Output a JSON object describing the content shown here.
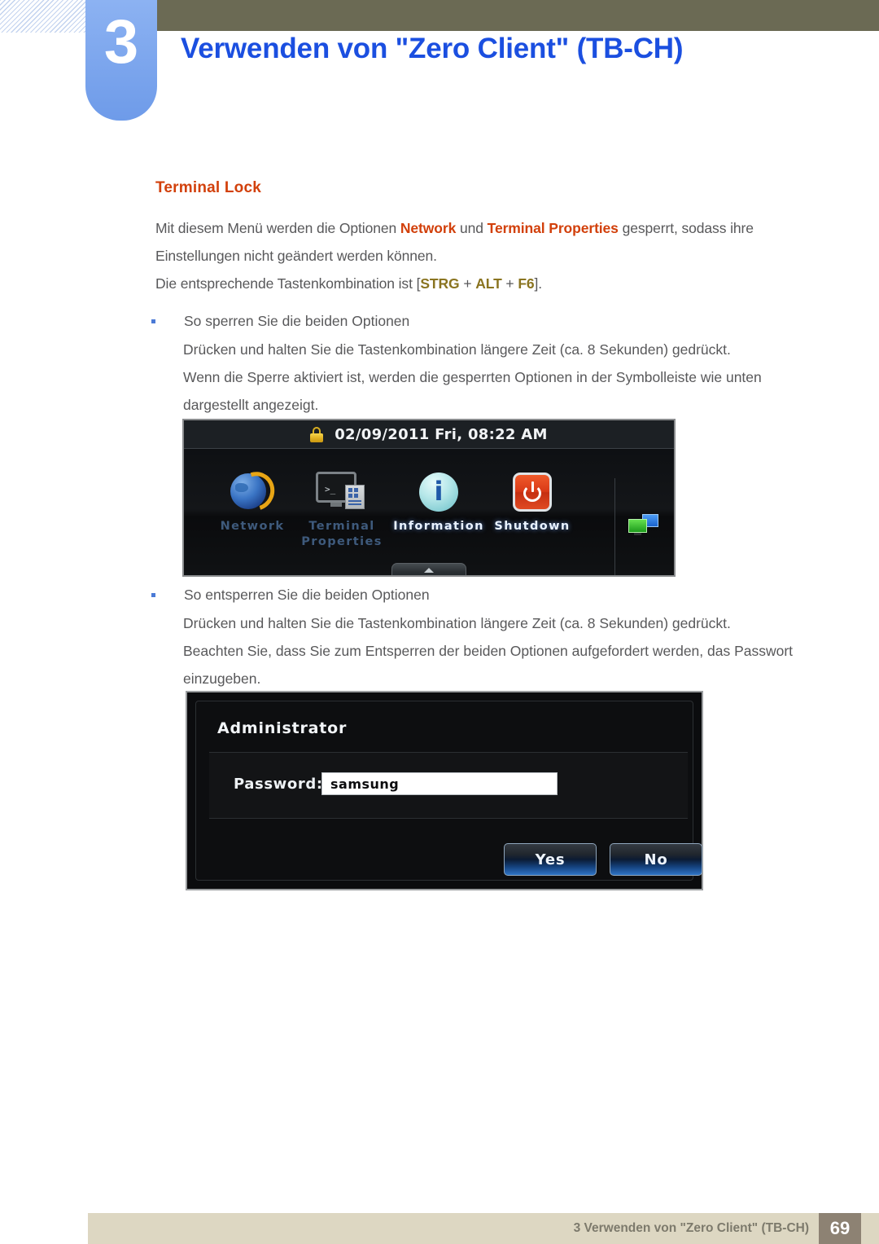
{
  "header": {
    "chapter_number": "3",
    "chapter_title": "Verwenden von \"Zero Client\" (TB-CH)"
  },
  "section": {
    "heading": "Terminal Lock",
    "paragraph_1": {
      "part_1": "Mit diesem Menü werden die Optionen ",
      "hl_1": "Network",
      "part_2": " und ",
      "hl_2": "Terminal Properties",
      "part_3": " gesperrt, sodass ihre Einstellungen nicht geändert werden können."
    },
    "paragraph_2": {
      "part_1": "Die entsprechende Tastenkombination ist [",
      "key_1": "STRG",
      "sep_1": " + ",
      "key_2": "ALT",
      "sep_2": " + ",
      "key_3": "F6",
      "part_2": "]."
    },
    "bullets": [
      {
        "label": "So sperren Sie die beiden Optionen",
        "line_1": "Drücken und halten Sie die Tastenkombination längere Zeit (ca. 8 Sekunden) gedrückt.",
        "line_2": "Wenn die Sperre aktiviert ist, werden die gesperrten Optionen in der Symbolleiste wie unten dargestellt angezeigt."
      },
      {
        "label": "So entsperren Sie die beiden Optionen",
        "line_1": "Drücken und halten Sie die Tastenkombination längere Zeit (ca. 8 Sekunden) gedrückt.",
        "line_2": "Beachten Sie, dass Sie zum Entsperren der beiden Optionen aufgefordert werden, das Passwort einzugeben."
      }
    ]
  },
  "toolbar_figure": {
    "lock_icon": "padlock-icon",
    "datetime": "02/09/2011 Fri, 08:22 AM",
    "items": [
      {
        "label": "Network",
        "icon": "globe-icon",
        "state": "locked"
      },
      {
        "label_line1": "Terminal",
        "label_line2": "Properties",
        "icon": "terminal-icon",
        "state": "locked"
      },
      {
        "label": "Information",
        "icon": "info-icon",
        "state": "active"
      },
      {
        "label": "Shutdown",
        "icon": "power-icon",
        "state": "active"
      }
    ],
    "tray_icon": "network-monitors-icon",
    "collapse_handle": "collapse-caret-icon"
  },
  "dialog_figure": {
    "title": "Administrator",
    "password_label": "Password:",
    "password_value": "samsung",
    "buttons": [
      {
        "label": "Yes"
      },
      {
        "label": "No"
      }
    ]
  },
  "footer": {
    "text": "3 Verwenden von \"Zero Client\" (TB-CH)",
    "page_number": "69"
  },
  "colors": {
    "accent_blue": "#1b4fe0",
    "chapter_tab": "#7ba6f0",
    "olive_bar": "#6b6a54",
    "heading_orange": "#d2400b",
    "key_gold": "#8a7420",
    "body_text": "#58585a",
    "footer_bg": "#ddd7c2",
    "footer_page_bg": "#8d8273"
  }
}
